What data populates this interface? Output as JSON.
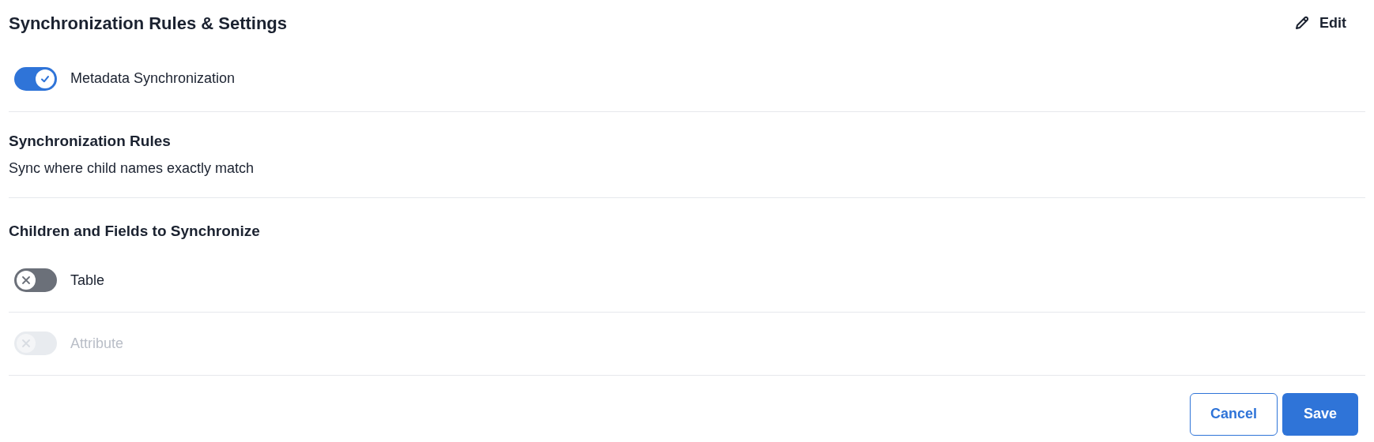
{
  "header": {
    "title": "Synchronization Rules & Settings",
    "edit_label": "Edit"
  },
  "metadata_toggle": {
    "label": "Metadata Synchronization",
    "on": true,
    "disabled": false
  },
  "rules": {
    "heading": "Synchronization Rules",
    "description": "Sync where child names exactly match"
  },
  "children_section": {
    "heading": "Children and Fields to Synchronize",
    "items": [
      {
        "label": "Table",
        "on": false,
        "disabled": false
      },
      {
        "label": "Attribute",
        "on": false,
        "disabled": true
      }
    ]
  },
  "buttons": {
    "cancel": "Cancel",
    "save": "Save"
  }
}
